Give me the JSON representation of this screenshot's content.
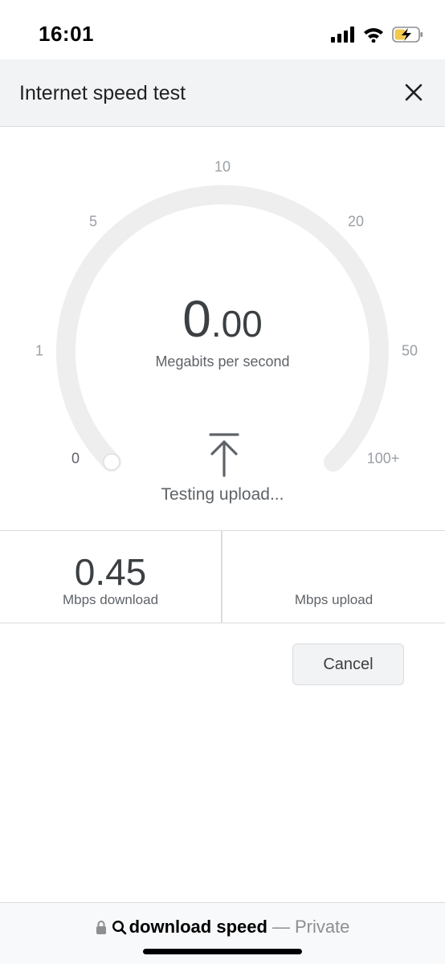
{
  "status_bar": {
    "time": "16:01",
    "icons": [
      "signal-icon",
      "wifi-icon",
      "battery-charging-icon"
    ]
  },
  "header": {
    "title": "Internet speed test",
    "close_icon": "close-icon"
  },
  "gauge": {
    "ticks": [
      "0",
      "1",
      "5",
      "10",
      "20",
      "50",
      "100+"
    ],
    "fill_fraction": 0,
    "speed_integer": "0",
    "speed_decimal": ".00",
    "unit": "Megabits per second",
    "phase_icon": "upload-arrow-icon",
    "status": "Testing upload..."
  },
  "results": {
    "download_value": "0.45",
    "download_label": "Mbps download",
    "upload_value": "",
    "upload_label": "Mbps upload"
  },
  "actions": {
    "cancel_label": "Cancel"
  },
  "address_bar": {
    "lock_icon": "lock-icon",
    "search_icon": "search-icon",
    "query": "download speed",
    "separator": "—",
    "mode": "Private"
  },
  "colors": {
    "track": "#eeeeee",
    "header_bg": "#f1f3f4",
    "divider": "#dadce0"
  }
}
